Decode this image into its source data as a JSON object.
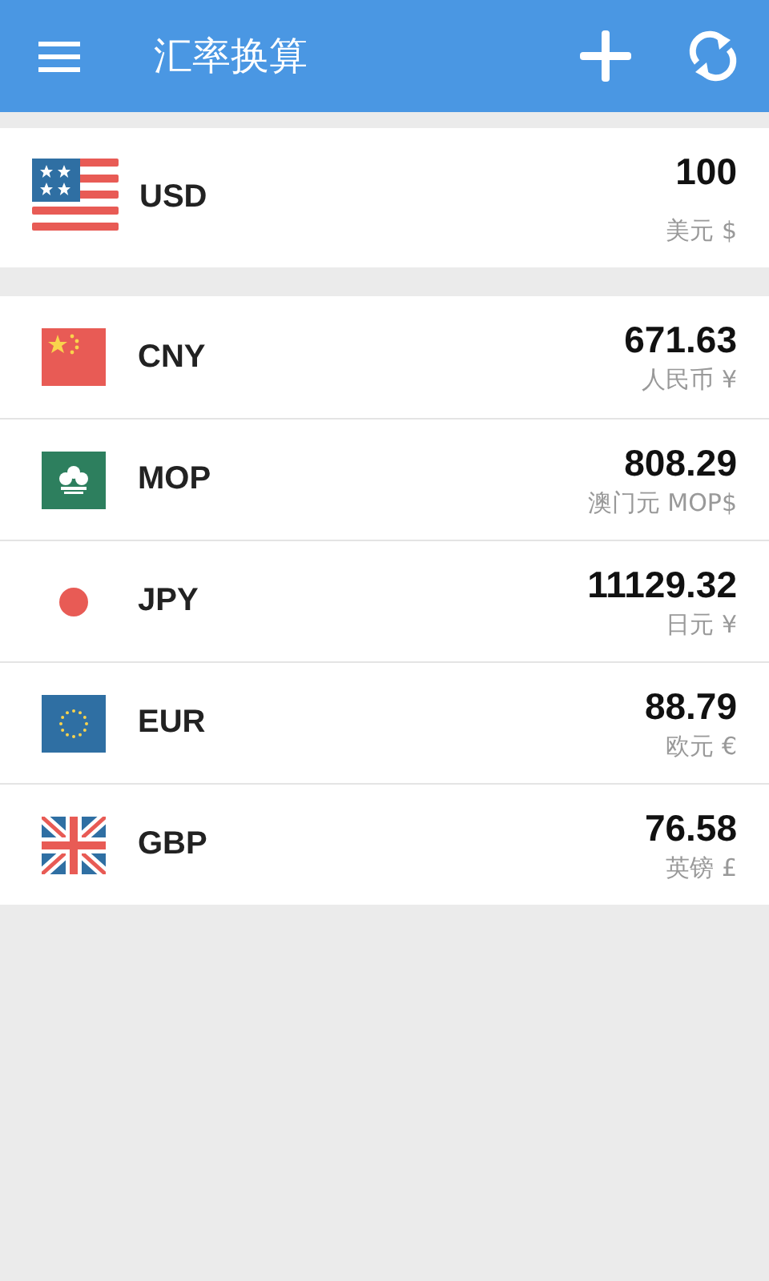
{
  "app_bar": {
    "title": "汇率换算"
  },
  "base": {
    "code": "USD",
    "kind": "us",
    "amount": "100",
    "name": "美元 $"
  },
  "rates": [
    {
      "code": "CNY",
      "kind": "cn",
      "amount": "671.63",
      "name": "人民币 ¥"
    },
    {
      "code": "MOP",
      "kind": "mo",
      "amount": "808.29",
      "name": "澳门元 MOP$"
    },
    {
      "code": "JPY",
      "kind": "jp",
      "amount": "11129.32",
      "name": "日元 ¥"
    },
    {
      "code": "EUR",
      "kind": "eu",
      "amount": "88.79",
      "name": "欧元 €"
    },
    {
      "code": "GBP",
      "kind": "gb",
      "amount": "76.58",
      "name": "英镑 £"
    }
  ]
}
